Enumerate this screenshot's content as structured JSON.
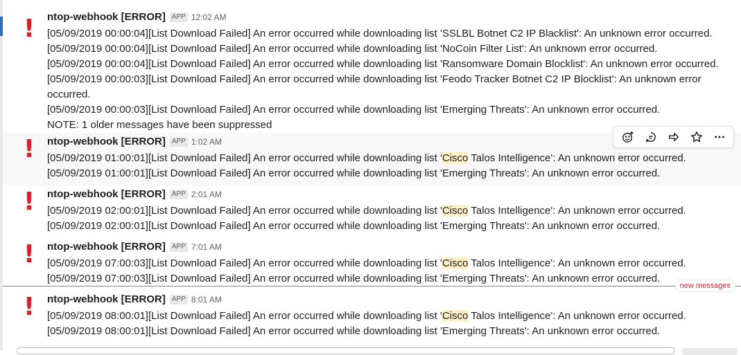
{
  "messages": [
    {
      "sender": "ntop-webhook [ERROR]",
      "badge": "APP",
      "time": "12:02 AM",
      "lines": [
        "[05/09/2019 00:00:04][List Download Failed] An error occurred while downloading list 'SSLBL Botnet C2 IP Blacklist': An unknown error occurred.",
        "[05/09/2019 00:00:04][List Download Failed] An error occurred while downloading list 'NoCoin Filter List': An unknown error occurred.",
        "[05/09/2019 00:00:04][List Download Failed] An error occurred while downloading list 'Ransomware Domain Blocklist': An unknown error occurred.",
        "[05/09/2019 00:00:03][List Download Failed] An error occurred while downloading list 'Feodo Tracker Botnet C2 IP Blocklist': An unknown error occurred.",
        "[05/09/2019 00:00:03][List Download Failed] An error occurred while downloading list 'Emerging Threats': An unknown error occurred.",
        "NOTE: 1 older messages have been suppressed"
      ]
    },
    {
      "sender": "ntop-webhook [ERROR]",
      "badge": "APP",
      "time": "1:02 AM",
      "line1_pre": "[05/09/2019 01:00:01][List Download Failed] An error occurred while downloading list '",
      "line1_hl": "Cisco",
      "line1_post": " Talos Intelligence': An unknown error occurred.",
      "line2": "[05/09/2019 01:00:01][List Download Failed] An error occurred while downloading list 'Emerging Threats': An unknown error occurred."
    },
    {
      "sender": "ntop-webhook [ERROR]",
      "badge": "APP",
      "time": "2:01 AM",
      "line1_pre": "[05/09/2019 02:00:01][List Download Failed] An error occurred while downloading list '",
      "line1_hl": "Cisco",
      "line1_post": " Talos Intelligence': An unknown error occurred.",
      "line2": "[05/09/2019 02:00:01][List Download Failed] An error occurred while downloading list 'Emerging Threats': An unknown error occurred."
    },
    {
      "sender": "ntop-webhook [ERROR]",
      "badge": "APP",
      "time": "7:01 AM",
      "line1_pre": "[05/09/2019 07:00:03][List Download Failed] An error occurred while downloading list '",
      "line1_hl": "Cisco",
      "line1_post": " Talos Intelligence': An unknown error occurred.",
      "line2": "[05/09/2019 07:00:03][List Download Failed] An error occurred while downloading list 'Emerging Threats': An unknown error occurred."
    },
    {
      "sender": "ntop-webhook [ERROR]",
      "badge": "APP",
      "time": "8:01 AM",
      "line1_pre": "[05/09/2019 08:00:01][List Download Failed] An error occurred while downloading list '",
      "line1_hl": "Cisco",
      "line1_post": " Talos Intelligence': An unknown error occurred.",
      "line2": "[05/09/2019 08:00:01][List Download Failed] An error occurred while downloading list 'Emerging Threats': An unknown error occurred."
    }
  ],
  "avatar_glyph": "!",
  "divider_label": "new messages",
  "toolbar_icons": [
    "add-reaction-icon",
    "thread-reply-icon",
    "share-icon",
    "star-icon",
    "more-actions-icon"
  ],
  "colors": {
    "error_red": "#e01e2a",
    "highlight": "#fcefc7",
    "divider": "#e8585e"
  }
}
